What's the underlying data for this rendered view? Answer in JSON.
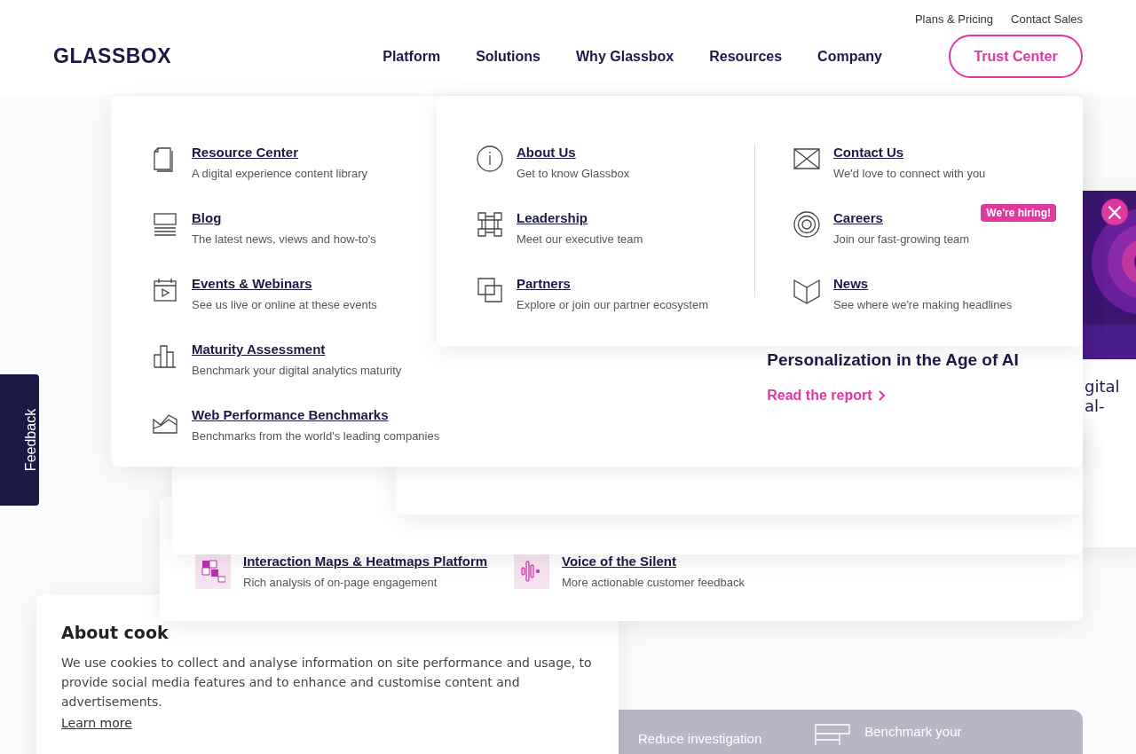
{
  "top_links": [
    "Plans & Pricing",
    "Contact Sales"
  ],
  "logo": "GLASSBOX",
  "nav": [
    "Platform",
    "Solutions",
    "Why Glassbox",
    "Resources",
    "Company"
  ],
  "trust_button": "Trust Center",
  "banner": {
    "close": "×",
    "fragments": [
      "gital",
      "al-"
    ]
  },
  "platform_menu": {
    "items": [
      {
        "title": "Interaction Maps & Heatmaps Platform",
        "description": "Rich analysis of on-page engagement"
      },
      {
        "title": "Voice of the Silent",
        "description": "More actionable customer feedback"
      }
    ]
  },
  "resources_menu": {
    "items": [
      {
        "title": "Resource Center",
        "description": "A digital experience content library"
      },
      {
        "title": "Blog",
        "description": "The latest news, views and how-to's"
      },
      {
        "title": "Events & Webinars",
        "description": "See us live or online at these events"
      },
      {
        "title": "Maturity Assessment",
        "description": "Benchmark your digital analytics maturity"
      },
      {
        "title": "Web Performance Benchmarks",
        "description": "Benchmarks from the world's leading companies"
      }
    ],
    "featured": {
      "title": "Personalization in the Age of AI",
      "link": "Read the report"
    }
  },
  "company_menu": {
    "columns": [
      [
        {
          "title": "About Us",
          "description": "Get to know Glassbox"
        },
        {
          "title": "Leadership",
          "description": "Meet our executive team"
        },
        {
          "title": "Partners",
          "description": "Explore or join our partner ecosystem"
        }
      ],
      [
        {
          "title": "Contact Us",
          "description": "We'd love to connect with you"
        },
        {
          "title": "Careers",
          "description": "Join our fast-growing team",
          "badge": "We're hiring!"
        },
        {
          "title": "News",
          "description": "See where we're making headlines"
        }
      ]
    ]
  },
  "feedback": "Feedback",
  "cookie": {
    "title": "About cook",
    "body": "We use cookies to collect and analyse information on site performance and usage, to provide social media features and to enhance and customise content and advertisements.",
    "link": "Learn more"
  },
  "bottom_card": {
    "items": [
      "Reduce investigation",
      "Benchmark your"
    ]
  }
}
